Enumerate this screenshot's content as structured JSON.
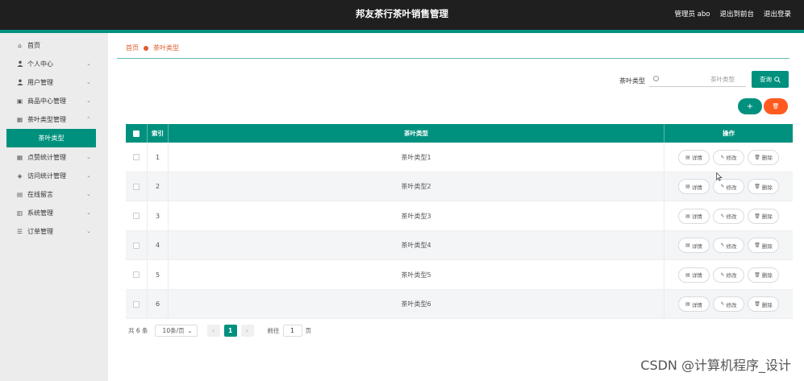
{
  "header": {
    "title": "邦友茶行茶叶销售管理",
    "user": "管理员 abo",
    "to_front": "退出到前台",
    "logout": "退出登录"
  },
  "sidebar": {
    "items": [
      {
        "label": "首页",
        "icon": "home-icon",
        "glyph": "⌂",
        "chevron": false
      },
      {
        "label": "个人中心",
        "icon": "user-icon",
        "glyph": "👤",
        "chevron": true
      },
      {
        "label": "用户管理",
        "icon": "user-icon",
        "glyph": "👤",
        "chevron": true
      },
      {
        "label": "商品中心管理",
        "icon": "box-icon",
        "glyph": "▣",
        "chevron": true
      },
      {
        "label": "茶叶类型管理",
        "icon": "grid-icon",
        "glyph": "▦",
        "chevron": true
      },
      {
        "label": "点赞统计管理",
        "icon": "grid-icon",
        "glyph": "▦",
        "chevron": true
      },
      {
        "label": "访问统计管理",
        "icon": "shield-icon",
        "glyph": "◈",
        "chevron": true
      },
      {
        "label": "在线留言",
        "icon": "message-icon",
        "glyph": "▤",
        "chevron": true
      },
      {
        "label": "系统管理",
        "icon": "settings-icon",
        "glyph": "▥",
        "chevron": true
      },
      {
        "label": "订单管理",
        "icon": "list-icon",
        "glyph": "☰",
        "chevron": true
      }
    ],
    "active_sub": "茶叶类型"
  },
  "breadcrumb": {
    "home": "首页",
    "current": "茶叶类型"
  },
  "search": {
    "label": "茶叶类型",
    "placeholder": "茶叶类型",
    "query_label": "查询"
  },
  "actions": {
    "add": "+",
    "delete": "🗑"
  },
  "table": {
    "headers": {
      "index": "索引",
      "name": "茶叶类型",
      "op": "操作"
    },
    "rows": [
      {
        "index": "1",
        "name": "茶叶类型1"
      },
      {
        "index": "2",
        "name": "茶叶类型2"
      },
      {
        "index": "3",
        "name": "茶叶类型3"
      },
      {
        "index": "4",
        "name": "茶叶类型4"
      },
      {
        "index": "5",
        "name": "茶叶类型5"
      },
      {
        "index": "6",
        "name": "茶叶类型6"
      }
    ],
    "op_labels": {
      "detail": "详情",
      "edit": "修改",
      "delete": "删除"
    }
  },
  "pagination": {
    "total": "共 6 条",
    "page_size": "10条/页",
    "current": "1",
    "goto_label": "前往",
    "goto_value": "1",
    "page_suffix": "页"
  },
  "watermark": "CSDN @计算机程序_设计",
  "colors": {
    "primary": "#00917e",
    "danger": "#ff5a1f",
    "header": "#1f1f1f"
  }
}
